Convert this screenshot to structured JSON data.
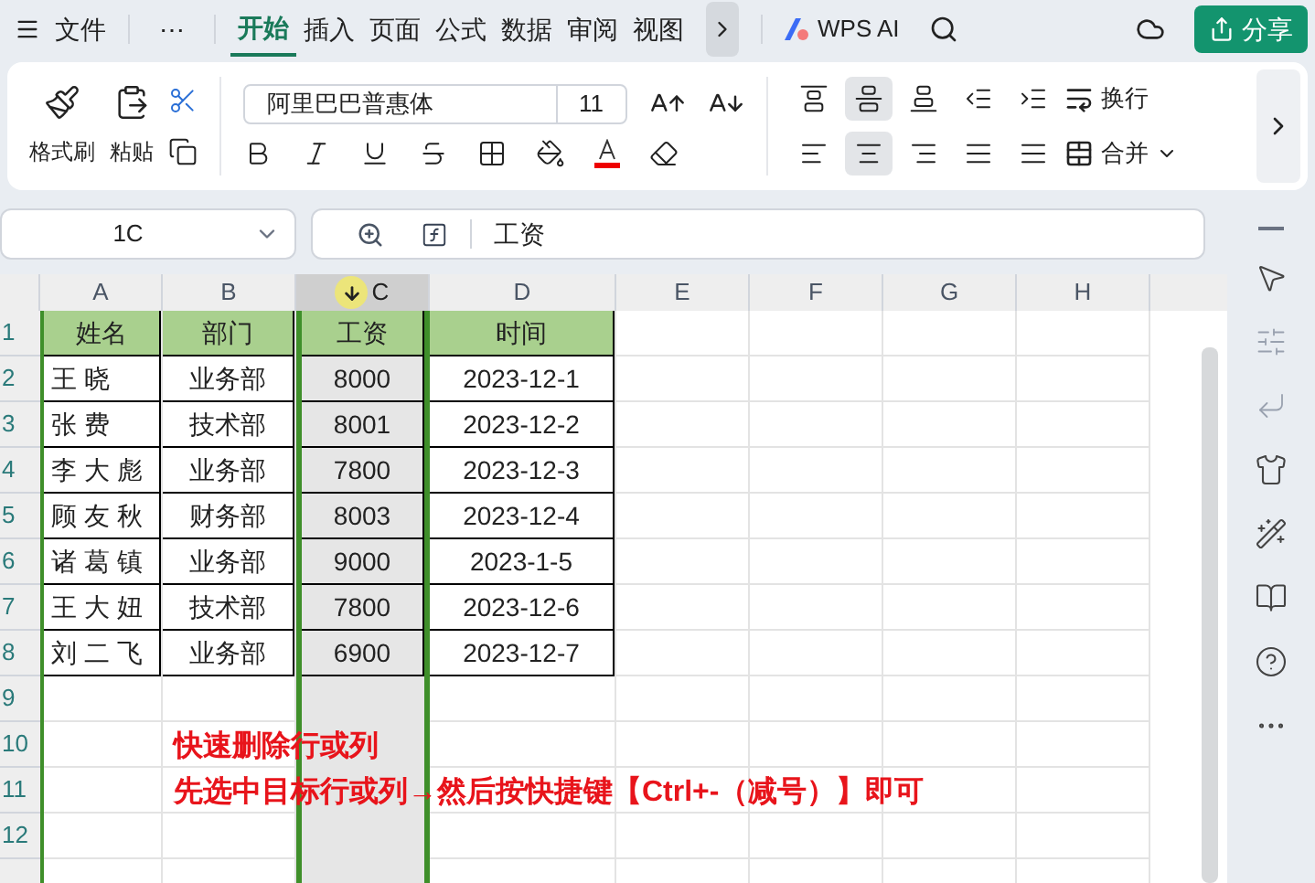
{
  "menu_tabs": [
    {
      "label": "文件",
      "selected": false
    },
    {
      "label": "开始",
      "selected": true
    },
    {
      "label": "插入",
      "selected": false
    },
    {
      "label": "页面",
      "selected": false
    },
    {
      "label": "公式",
      "selected": false
    },
    {
      "label": "数据",
      "selected": false
    },
    {
      "label": "审阅",
      "selected": false
    },
    {
      "label": "视图",
      "selected": false
    }
  ],
  "more_menu": "⋯",
  "ai_label": "WPS AI",
  "share_button": "分享",
  "ribbon": {
    "format_painter": "格式刷",
    "paste": "粘贴",
    "font": "阿里巴巴普惠体",
    "font_size": "11",
    "wrap": "换行",
    "merge": "合并",
    "align_buttons": [
      {
        "kind": "top",
        "selected": false
      },
      {
        "kind": "middle",
        "selected": true
      },
      {
        "kind": "bottom",
        "selected": false
      },
      {
        "kind": "outdent",
        "selected": false
      },
      {
        "kind": "indent",
        "selected": false
      },
      {
        "kind": "left",
        "selected": false
      },
      {
        "kind": "center",
        "selected": true
      },
      {
        "kind": "right",
        "selected": false
      },
      {
        "kind": "justify",
        "selected": false
      },
      {
        "kind": "distribute",
        "selected": false
      }
    ]
  },
  "name_box": "1C",
  "formula": "工资",
  "columns": [
    {
      "label": "A",
      "selected": false
    },
    {
      "label": "B",
      "selected": false
    },
    {
      "label": "C",
      "selected": true
    },
    {
      "label": "D",
      "selected": false
    },
    {
      "label": "E",
      "selected": false
    },
    {
      "label": "F",
      "selected": false
    },
    {
      "label": "G",
      "selected": false
    },
    {
      "label": "H",
      "selected": false
    }
  ],
  "row_numbers": [
    "1",
    "2",
    "3",
    "4",
    "5",
    "6",
    "7",
    "8",
    "9",
    "10",
    "11",
    "12"
  ],
  "table": {
    "header": [
      "姓名",
      "部门",
      "工资",
      "时间"
    ],
    "rows": [
      [
        "王 晓",
        "业务部",
        "8000",
        "2023-12-1"
      ],
      [
        "张 费",
        "技术部",
        "8001",
        "2023-12-2"
      ],
      [
        "李 大 彪",
        "业务部",
        "7800",
        "2023-12-3"
      ],
      [
        "顾 友 秋",
        "财务部",
        "8003",
        "2023-12-4"
      ],
      [
        "诸 葛 镇",
        "业务部",
        "9000",
        "2023-1-5"
      ],
      [
        "王 大 妞",
        "技术部",
        "7800",
        "2023-12-6"
      ],
      [
        "刘 二 飞",
        "业务部",
        "6900",
        "2023-12-7"
      ]
    ]
  },
  "note": [
    "快速删除行或列",
    "先选中目标行或列→然后按快捷键【Ctrl+-（减号）】即可"
  ]
}
